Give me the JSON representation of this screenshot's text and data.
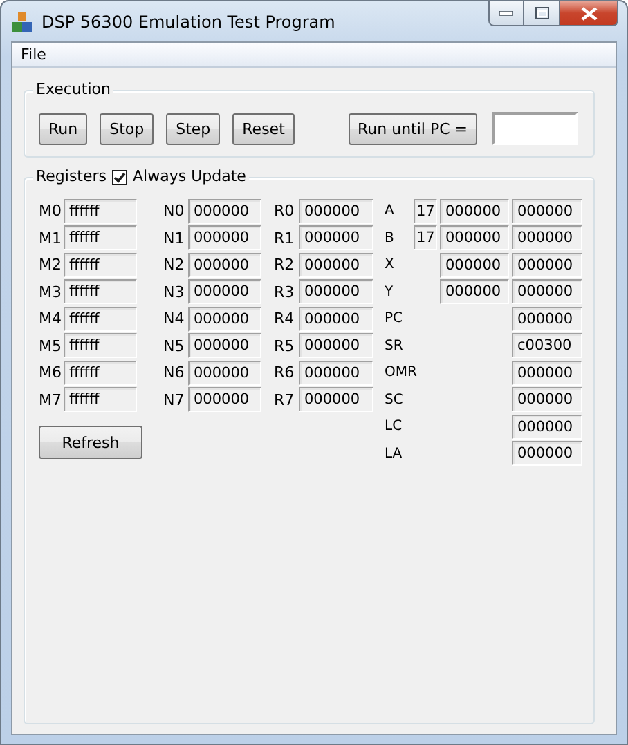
{
  "window": {
    "title": "DSP 56300 Emulation Test Program"
  },
  "menu": [
    {
      "label": "File"
    }
  ],
  "execution": {
    "title": "Execution",
    "buttons": [
      "Run",
      "Stop",
      "Step",
      "Reset"
    ],
    "run_until": {
      "label": "Run until PC ="
    }
  },
  "registers": {
    "title": "Registers",
    "always_update": {
      "label": "Always Update",
      "checked": true
    },
    "columns": [
      {
        "rows": [
          {
            "label": "M0",
            "value": "ffffff"
          },
          {
            "label": "M1",
            "value": "ffffff"
          },
          {
            "label": "M2",
            "value": "ffffff"
          },
          {
            "label": "M3",
            "value": "ffffff"
          },
          {
            "label": "M4",
            "value": "ffffff"
          },
          {
            "label": "M5",
            "value": "ffffff"
          },
          {
            "label": "M6",
            "value": "ffffff"
          },
          {
            "label": "M7",
            "value": "ffffff"
          }
        ]
      },
      {
        "rows": [
          {
            "label": "N0",
            "value": "000000"
          },
          {
            "label": "N1",
            "value": "000000"
          },
          {
            "label": "N2",
            "value": "000000"
          },
          {
            "label": "N3",
            "value": "000000"
          },
          {
            "label": "N4",
            "value": "000000"
          },
          {
            "label": "N5",
            "value": "000000"
          },
          {
            "label": "N6",
            "value": "000000"
          },
          {
            "label": "N7",
            "value": "000000"
          }
        ]
      },
      {
        "rows": [
          {
            "label": "R0",
            "value": "000000"
          },
          {
            "label": "R1",
            "value": "000000"
          },
          {
            "label": "R2",
            "value": "000000"
          },
          {
            "label": "R3",
            "value": "000000"
          },
          {
            "label": "R4",
            "value": "000000"
          },
          {
            "label": "R5",
            "value": "000000"
          },
          {
            "label": "R6",
            "value": "000000"
          },
          {
            "label": "R7",
            "value": "000000"
          }
        ]
      }
    ],
    "special": [
      {
        "label": "A",
        "extension": "17",
        "high": "000000",
        "low": "000000"
      },
      {
        "label": "B",
        "extension": "17",
        "high": "000000",
        "low": "000000"
      },
      {
        "label": "X",
        "high": "000000",
        "low": "000000"
      },
      {
        "label": "Y",
        "high": "000000",
        "low": "000000"
      },
      {
        "label": "PC",
        "low": "000000"
      },
      {
        "label": "SR",
        "low": "c00300"
      },
      {
        "label": "OMR",
        "low": "000000"
      },
      {
        "label": "SC",
        "low": "000000"
      },
      {
        "label": "LC",
        "low": "000000"
      },
      {
        "label": "LA",
        "low": "000000"
      }
    ],
    "refresh_button": "Refresh"
  }
}
